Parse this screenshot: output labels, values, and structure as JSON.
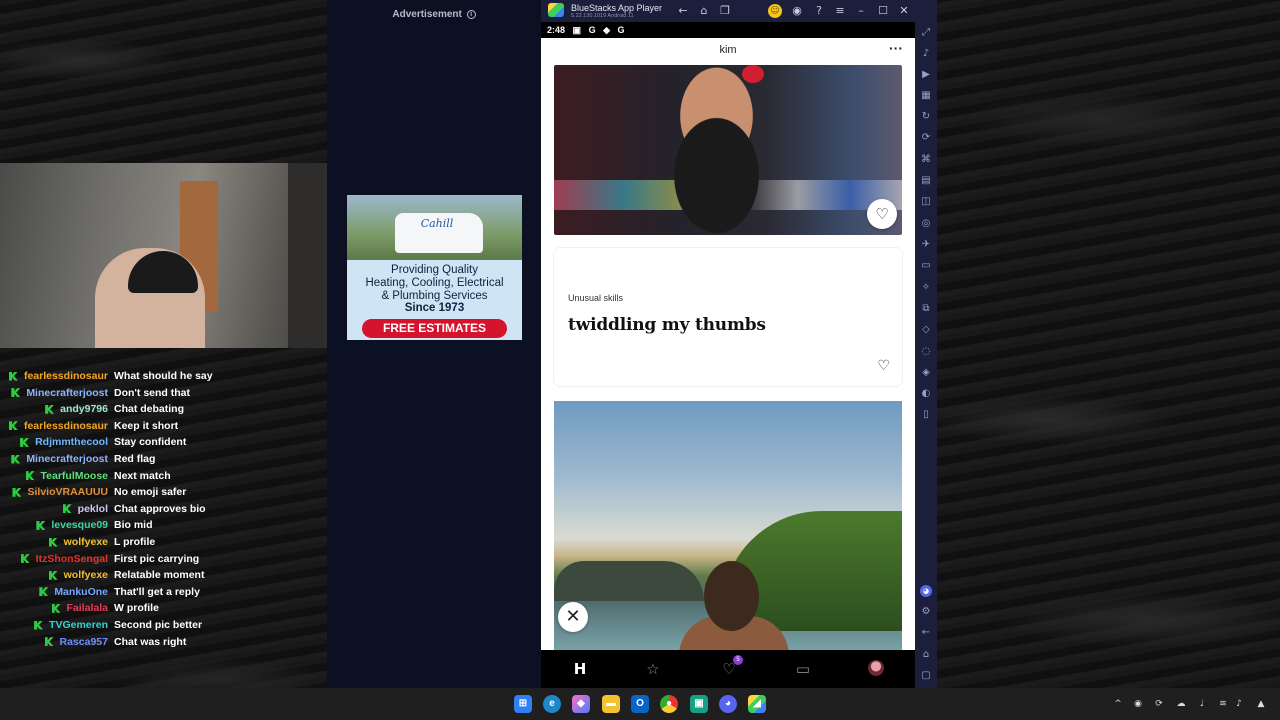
{
  "chat": {
    "messages": [
      {
        "user": "fearlessdinosaur",
        "color": "#f5a623",
        "text": "What should he say"
      },
      {
        "user": "Minecrafterjoost",
        "color": "#8fb4ff",
        "text": "Don't send that"
      },
      {
        "user": "andy9796",
        "color": "#9fe6c5",
        "text": "Chat debating"
      },
      {
        "user": "fearlessdinosaur",
        "color": "#f5a623",
        "text": "Keep it short"
      },
      {
        "user": "Rdjmmthecool",
        "color": "#6fb8ff",
        "text": "Stay confident"
      },
      {
        "user": "Minecrafterjoost",
        "color": "#8fb4ff",
        "text": "Red flag"
      },
      {
        "user": "TearfulMoose",
        "color": "#5ee07c",
        "text": "Next match"
      },
      {
        "user": "SilvioVRAAUUU",
        "color": "#e0913c",
        "text": "No emoji safer"
      },
      {
        "user": "peklol",
        "color": "#c9c9ff",
        "text": "Chat approves bio"
      },
      {
        "user": "levesque09",
        "color": "#3cd7a0",
        "text": "Bio mid"
      },
      {
        "user": "wolfyexe",
        "color": "#f2c230",
        "text": "L profile"
      },
      {
        "user": "ItzShonSengal",
        "color": "#e8322a",
        "text": "First pic carrying"
      },
      {
        "user": "wolfyexe",
        "color": "#f2c230",
        "text": "Relatable moment"
      },
      {
        "user": "MankuOne",
        "color": "#7aa6ff",
        "text": "That'll get a reply"
      },
      {
        "user": "Failalala",
        "color": "#e83a5a",
        "text": "W profile"
      },
      {
        "user": "TVGemeren",
        "color": "#2fd3d0",
        "text": "Second pic better"
      },
      {
        "user": "Rasca957",
        "color": "#6e8fff",
        "text": "Chat was right"
      }
    ]
  },
  "ad": {
    "label": "Advertisement",
    "info_icon": "info-icon",
    "brand": "Cahill",
    "line1": "Providing Quality",
    "line2": "Heating, Cooling, Electrical",
    "line3": "& Plumbing Services",
    "since": "Since 1973",
    "cta": "FREE ESTIMATES"
  },
  "emulator": {
    "title": "BlueStacks App Player",
    "version": "5.22.130.1019  Android 11",
    "titlebar_icons": [
      "back-icon",
      "home-icon",
      "multitask-icon",
      "coin-icon",
      "account-icon",
      "help-icon",
      "menu-icon",
      "minimize-icon",
      "maximize-icon",
      "close-icon",
      "collapse-sidebar-icon"
    ]
  },
  "phone": {
    "status_time": "2:48",
    "status_icons": [
      "notification-icon",
      "g-icon",
      "shield-icon",
      "g-icon"
    ],
    "profile_name": "kim",
    "more_label": "···",
    "prompt": {
      "question": "Unusual skills",
      "answer": "twiddling my thumbs"
    },
    "nav": {
      "likes_badge": "5"
    }
  },
  "colors": {
    "ad_background": "#0b1022",
    "emulator_chrome": "#1b1f3b",
    "ad_cta": "#d6132c"
  }
}
